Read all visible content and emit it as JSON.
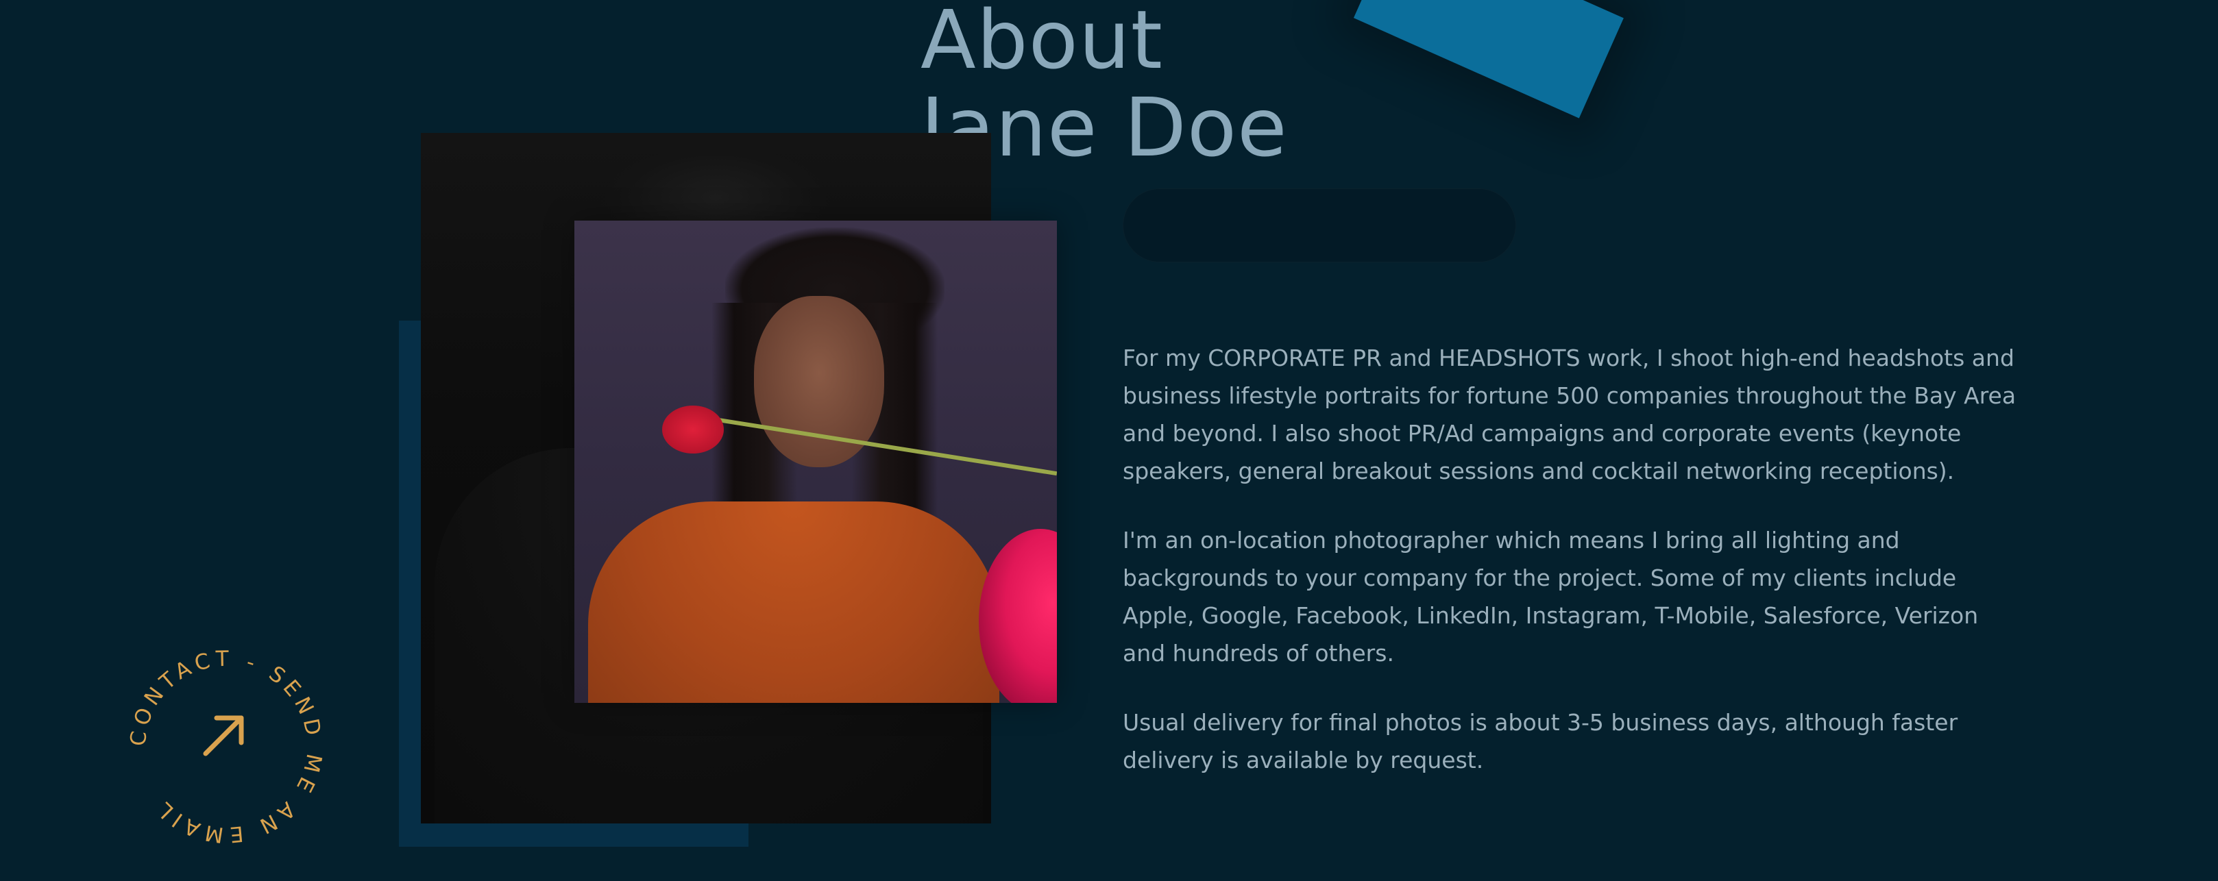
{
  "title": {
    "line1": "About",
    "line2": "Jane Doe"
  },
  "bio": {
    "paragraphs": [
      "For my CORPORATE PR and HEADSHOTS work, I shoot high-end headshots and business lifestyle portraits for fortune 500 companies throughout the Bay Area and beyond. I also shoot PR/Ad campaigns and corporate events (keynote speakers, general breakout sessions and cocktail networking receptions).",
      "I'm an on-location photographer which means I bring all lighting and backgrounds to your company for the project. Some of my clients include Apple, Google, Facebook, LinkedIn, Instagram, T-Mobile, Salesforce, Verizon and hundreds of others.",
      "Usual delivery for final photos is about 3-5 business days, although faster delivery is available by request."
    ]
  },
  "contact": {
    "ring_text": "CONTACT - SEND ME AN EMAIL",
    "icon": "arrow-up-right-icon"
  },
  "colors": {
    "background": "#04202d",
    "title": "#8aa8ba",
    "body_text": "#9bb0bc",
    "accent": "#d9a24e",
    "panel": "#062f47"
  }
}
